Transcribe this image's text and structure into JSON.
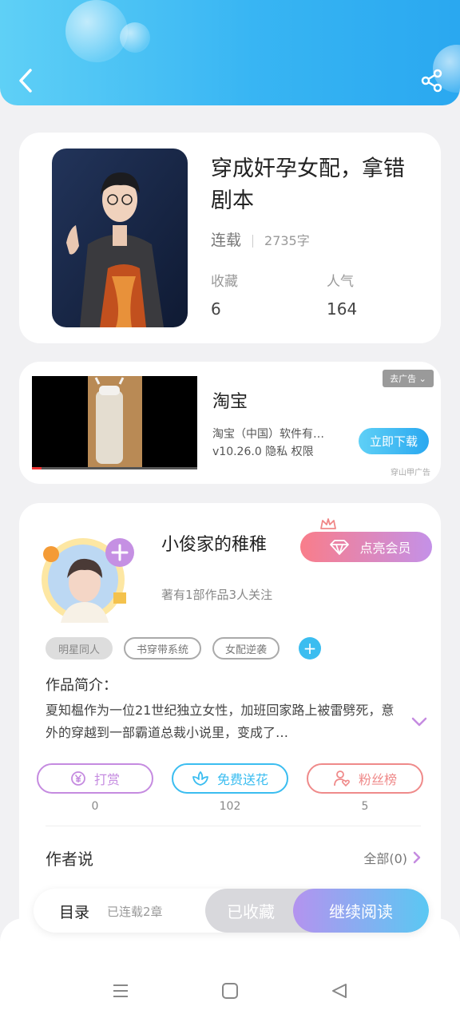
{
  "header": {
    "back_icon": "chevron-left-icon",
    "share_icon": "share-icon"
  },
  "book": {
    "title": "穿成奸孕女配，拿错剧本",
    "status": "连载",
    "word_count": "2735字",
    "collect_label": "收藏",
    "collect_value": "6",
    "popularity_label": "人气",
    "popularity_value": "164"
  },
  "ad": {
    "title": "淘宝",
    "desc_line1": "淘宝（中国）软件有…",
    "desc_line2": "v10.26.0  隐私  权限",
    "download_label": "立即下载",
    "close_label": "去广告",
    "source_label": "穿山甲广告"
  },
  "author": {
    "name": "小俊家的稚稚",
    "meta": "著有1部作品3人关注",
    "vip_label": "点亮会员",
    "tags": [
      "明星同人",
      "书穿带系统",
      "女配逆袭"
    ],
    "intro_label": "作品简介：",
    "intro_text": "夏知榅作为一位21世纪独立女性，加班回家路上被雷劈死，意外的穿越到一部霸道总裁小说里，变成了…",
    "actions": [
      {
        "label": "打赏",
        "count": "0"
      },
      {
        "label": "免费送花",
        "count": "102"
      },
      {
        "label": "粉丝榜",
        "count": "5"
      }
    ],
    "say_label": "作者说",
    "say_all": "全部(0)"
  },
  "bottom_bar": {
    "toc_label": "目录",
    "toc_status": "已连载2章",
    "collected_label": "已收藏",
    "read_label": "继续阅读"
  },
  "colors": {
    "header_start": "#5fd0f6",
    "header_end": "#2aa8f0",
    "reward": "#c58be0",
    "flower": "#3bbdf0",
    "fans": "#ef8a8a"
  }
}
